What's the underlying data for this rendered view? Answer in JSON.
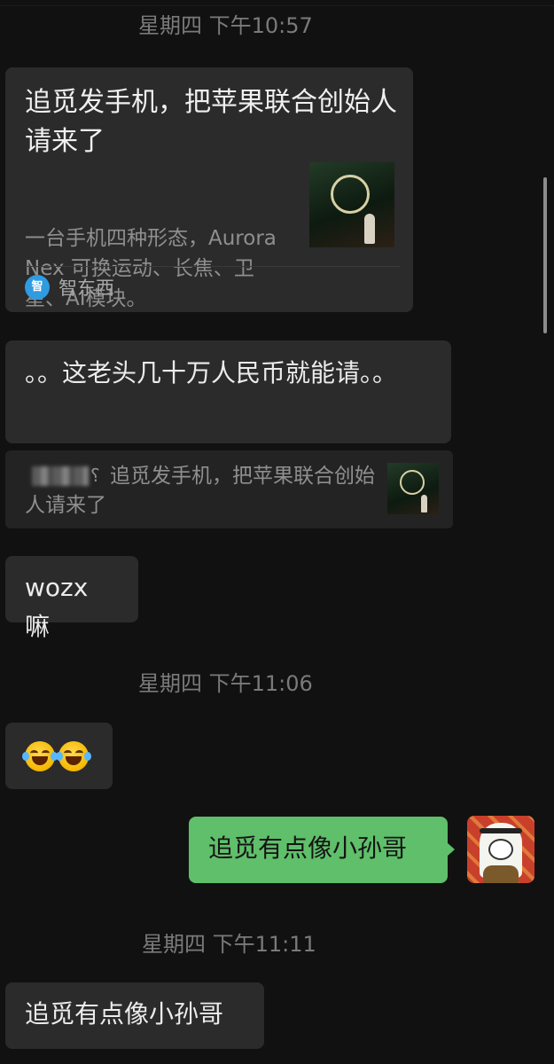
{
  "timestamps": {
    "t1": "星期四 下午10:57",
    "t2": "星期四 下午11:06",
    "t3": "星期四 下午11:11"
  },
  "link_card": {
    "title": "追觅发手机，把苹果联合创始人请来了",
    "description": "一台手机四种形态，Aurora Nex 可换运动、长焦、卫星、AI模块。",
    "source_icon_text": "智",
    "source_name": "智东西"
  },
  "messages": {
    "reply_text": "。。这老头几十万人民币就能请。。",
    "quoted_text": "追觅发手机，把苹果联合创始人请来了",
    "wozx_text": "wozx 嘛",
    "emoji_names": [
      "face-with-tears-of-joy-icon",
      "face-with-tears-of-joy-icon"
    ],
    "outgoing_text": "追觅有点像小孙哥",
    "last_text": "追觅有点像小孙哥"
  },
  "colors": {
    "background": "#111111",
    "bubble": "#2b2b2b",
    "outgoing_bubble": "#5fbf6a",
    "timestamp": "#7a7a7a",
    "source_icon": "#2f9be0"
  }
}
